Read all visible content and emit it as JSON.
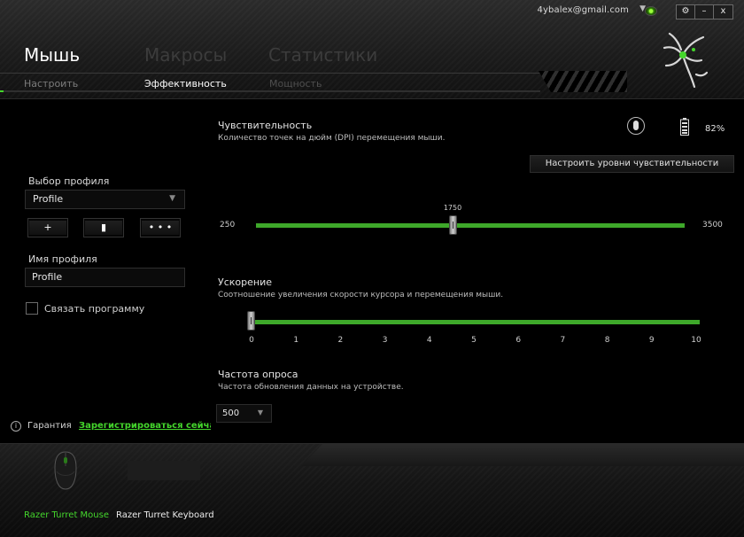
{
  "account": {
    "email": "4ybalex@gmail.com"
  },
  "window_controls": {
    "settings": "⚙",
    "minimize": "–",
    "close": "x"
  },
  "tabs": [
    {
      "label": "Мышь",
      "active": true
    },
    {
      "label": "Макросы",
      "active": false
    },
    {
      "label": "Статистики",
      "active": false
    }
  ],
  "subtabs": [
    {
      "label": "Настроить",
      "active": false
    },
    {
      "label": "Эффективность",
      "active": true
    },
    {
      "label": "Мощность",
      "active": false
    }
  ],
  "sidebar": {
    "profile_select_label": "Выбор профиля",
    "profile_value": "Profile",
    "profile_buttons": [
      "+",
      "▮",
      "• • •"
    ],
    "profile_name_label": "Имя профиля",
    "profile_name_value": "Profile",
    "link_program_label": "Связать программу",
    "link_program_checked": false,
    "warranty_label": "Гарантия",
    "register_label": "Зарегистрироваться сейчас"
  },
  "device_status": {
    "battery_pct": "82%"
  },
  "sensitivity": {
    "title": "Чувствительность",
    "subtitle": "Количество точек на дюйм (DPI) перемещения мыши.",
    "levels_button": "Настроить уровни чувствительности",
    "min": "250",
    "max": "3500",
    "value": "1750",
    "value_num": 1750,
    "min_num": 250,
    "max_num": 3500
  },
  "acceleration": {
    "title": "Ускорение",
    "subtitle": "Соотношение увеличения скорости курсора и перемещения мыши.",
    "ticks": [
      "0",
      "1",
      "2",
      "3",
      "4",
      "5",
      "6",
      "7",
      "8",
      "9",
      "10"
    ],
    "value_num": 0
  },
  "polling": {
    "title": "Частота опроса",
    "subtitle": "Частота обновления данных на устройстве.",
    "value": "500"
  },
  "devices": [
    {
      "name": "Razer Turret Mouse",
      "active": true
    },
    {
      "name": "Razer Turret Keyboard",
      "active": false
    }
  ],
  "colors": {
    "accent": "#44d62c",
    "track": "#3ea82a"
  }
}
